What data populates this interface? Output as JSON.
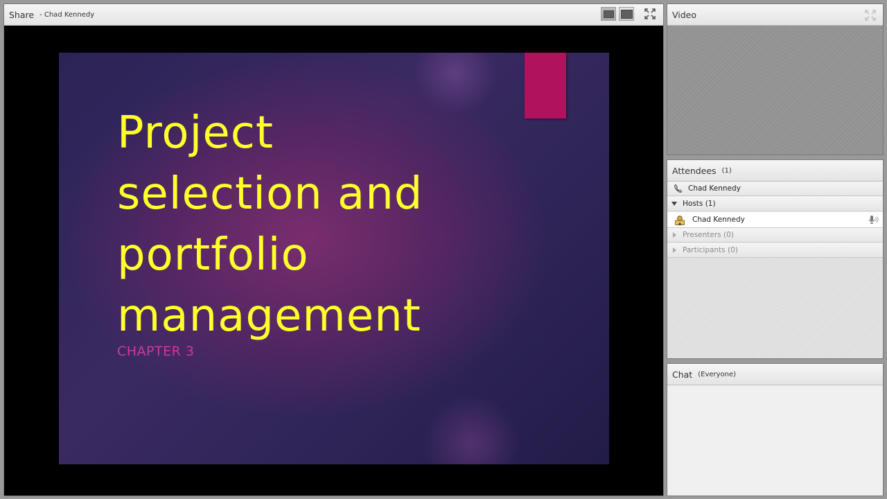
{
  "share_pod": {
    "title": "Share",
    "presenter": "- Chad Kennedy",
    "slide": {
      "title": "Project\nselection and\nportfolio\nmanagement",
      "subtitle": "CHAPTER 3"
    }
  },
  "video_pod": {
    "title": "Video"
  },
  "attendees_pod": {
    "title": "Attendees",
    "count": "(1)",
    "phone_user": "Chad Kennedy",
    "groups": [
      {
        "label": "Hosts (1)",
        "expanded": true
      },
      {
        "label": "Presenters (0)",
        "expanded": false
      },
      {
        "label": "Participants (0)",
        "expanded": false
      }
    ],
    "host_user": "Chad Kennedy"
  },
  "chat_pod": {
    "title": "Chat",
    "scope": "(Everyone)"
  },
  "colors": {
    "slide_title": "#ffff2b",
    "slide_subtitle": "#d0389a",
    "slide_accent": "#b0125e"
  },
  "icons": [
    "screen-view-icon",
    "fullscreen-icon",
    "expand-icon",
    "phone-icon",
    "host-user-icon",
    "microphone-icon"
  ]
}
